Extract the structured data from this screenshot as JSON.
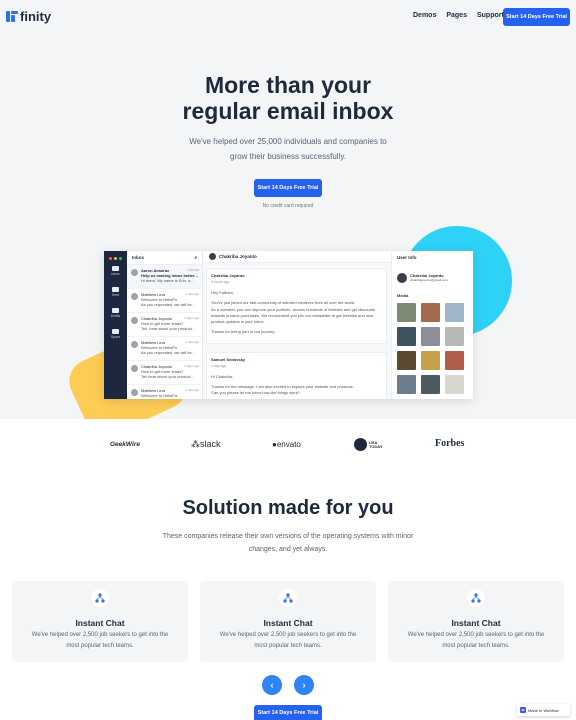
{
  "nav": {
    "logo_text": "finity",
    "links": [
      "Demos",
      "Pages",
      "Support"
    ],
    "cta": "Start 14 Days Free Trial"
  },
  "hero": {
    "headline_1": "More than your",
    "headline_2": "regular email inbox",
    "sub_1": "We've helped over 25,000 individuals and companies to",
    "sub_2": "grow their business successfully.",
    "cta": "Start 14 Days Free Trial",
    "note": "No credit card required"
  },
  "app": {
    "sidebar": [
      "Inbox",
      "Sent",
      "Drafts",
      "Spam"
    ],
    "inbox_title": "Inbox",
    "messages": [
      {
        "name": "Aaron Almaraz",
        "time": "4:50 PM",
        "subject": "Help us making inbox better...",
        "preview": "Hi there, My name is Erin, a..."
      },
      {
        "name": "Matthew Lina",
        "time": "1 day ago",
        "subject": "Welcome to HelloPo",
        "preview": "As you requested, we will be..."
      },
      {
        "name": "Chakriba Joyanto",
        "time": "3 days ago",
        "subject": "How to get more leads?",
        "preview": "Tell, hear about your product..."
      },
      {
        "name": "Matthew Lina",
        "time": "1 day ago",
        "subject": "Welcome to HelloPo",
        "preview": "As you requested, we will be..."
      },
      {
        "name": "Chakriba Joyanto",
        "time": "3 days ago",
        "subject": "How to get more leads?",
        "preview": "Tell hear about your product..."
      },
      {
        "name": "Matthew Lina",
        "time": "1 day ago",
        "subject": "Welcome to HelloPo",
        "preview": ""
      }
    ],
    "conversation_title": "Chakriba Joyanto",
    "email1": {
      "from": "Chakriba Joyanto",
      "time": "3 hours ago",
      "greeting": "Hey Fatham,",
      "body_1": "You've just joined our fast community of talented creatives from all over the world.",
      "body_2": "As a member, you can improve your portfolio, access hundreds of freebies and get discounts towards product purchases. We recommend you join our newsletter to get freebies and new product updates in your inbox.",
      "body_3": "Thanks for being part of our journey."
    },
    "email2": {
      "from": "Samuel Sedovsky",
      "time": "1 day ago",
      "greeting": "Hi Chakriba,",
      "body_1": "Thanks for the message. I am also excited to explore your website and products.",
      "body_2": "Can you please let me know how the things work?"
    },
    "user_info_title": "User Info",
    "user_name": "Chakriba Joyanto",
    "user_email": "chakribajoyanto@gmail.com",
    "media_label": "Media"
  },
  "logos": [
    "GeekWire",
    "slack",
    "envato",
    "USA TODAY",
    "Forbes"
  ],
  "solution": {
    "title": "Solution made for you",
    "sub_1": "These companies release their own versions of the operating systems with minor",
    "sub_2": "changes, and yet always.",
    "features": [
      {
        "title": "Instant Chat",
        "desc_1": "We've helped over 2,500 job seekers to get into the",
        "desc_2": "most popular tech teams."
      },
      {
        "title": "Instant Chat",
        "desc_1": "We've helped over 2,500 job seekers to get into the",
        "desc_2": "most popular tech teams."
      },
      {
        "title": "Instant Chat",
        "desc_1": "We've helped over 2,500 job seekers to get into the",
        "desc_2": "most popular tech teams."
      }
    ],
    "prev": "‹",
    "next": "›",
    "cta": "Start 14 Days Free Trial"
  },
  "webflow_badge": "Made in Webflow",
  "colors": {
    "accent": "#2662f0",
    "cyan": "#2ed2f6",
    "yellow": "#fccc55",
    "sidebar": "#1e2740"
  }
}
